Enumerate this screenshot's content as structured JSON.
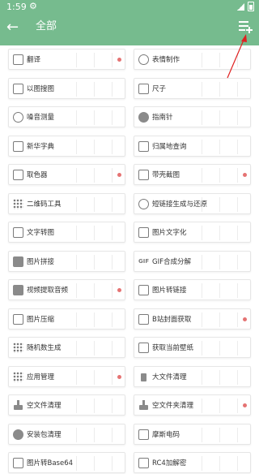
{
  "status_bar": {
    "time": "1:59"
  },
  "header": {
    "title": "全部",
    "accent": "#76bb8e"
  },
  "icons": {
    "back": "arrow-left-icon",
    "menu": "playlist-add-icon"
  },
  "badge_color": "#e57373",
  "items": [
    {
      "left": {
        "label": "翻译",
        "icon": "translate-icon",
        "dot": true
      },
      "right": {
        "label": "表情制作",
        "icon": "emoji-icon",
        "dot": false
      }
    },
    {
      "left": {
        "label": "以图搜图",
        "icon": "image-search-icon",
        "dot": false
      },
      "right": {
        "label": "尺子",
        "icon": "ruler-icon",
        "dot": false
      }
    },
    {
      "left": {
        "label": "噪音测量",
        "icon": "noise-icon",
        "dot": false
      },
      "right": {
        "label": "指南针",
        "icon": "compass-icon",
        "dot": false
      }
    },
    {
      "left": {
        "label": "新华字典",
        "icon": "book-icon",
        "dot": false
      },
      "right": {
        "label": "归属地查询",
        "icon": "phone-icon",
        "dot": false
      }
    },
    {
      "left": {
        "label": "取色器",
        "icon": "color-picker-icon",
        "dot": true
      },
      "right": {
        "label": "带壳截图",
        "icon": "phone-frame-icon",
        "dot": true
      }
    },
    {
      "left": {
        "label": "二维码工具",
        "icon": "qrcode-icon",
        "dot": false
      },
      "right": {
        "label": "短链接生成与还原",
        "icon": "link-icon",
        "dot": false
      }
    },
    {
      "left": {
        "label": "文字转图",
        "icon": "text-image-icon",
        "dot": false
      },
      "right": {
        "label": "图片文字化",
        "icon": "image-text-icon",
        "dot": false
      }
    },
    {
      "left": {
        "label": "图片拼接",
        "icon": "image-join-icon",
        "dot": false
      },
      "right": {
        "label": "GIF合成分解",
        "icon": "gif-icon",
        "dot": false
      }
    },
    {
      "left": {
        "label": "视频提取音频",
        "icon": "video-audio-icon",
        "dot": true
      },
      "right": {
        "label": "图片转链接",
        "icon": "image-link-icon",
        "dot": false
      }
    },
    {
      "left": {
        "label": "图片压缩",
        "icon": "image-compress-icon",
        "dot": false
      },
      "right": {
        "label": "B站封面获取",
        "icon": "cover-icon",
        "dot": true
      }
    },
    {
      "left": {
        "label": "随机数生成",
        "icon": "dice-icon",
        "dot": false
      },
      "right": {
        "label": "获取当前壁纸",
        "icon": "wallpaper-icon",
        "dot": false
      }
    },
    {
      "left": {
        "label": "应用管理",
        "icon": "apps-icon",
        "dot": true
      },
      "right": {
        "label": "大文件清理",
        "icon": "trash-icon",
        "dot": false
      }
    },
    {
      "left": {
        "label": "空文件清理",
        "icon": "brush-icon",
        "dot": false
      },
      "right": {
        "label": "空文件夹清理",
        "icon": "brush-icon",
        "dot": true
      }
    },
    {
      "left": {
        "label": "安装包清理",
        "icon": "circle-icon",
        "dot": false
      },
      "right": {
        "label": "摩斯电码",
        "icon": "morse-icon",
        "dot": false
      }
    },
    {
      "left": {
        "label": "图片转Base64",
        "icon": "image-base64-icon",
        "dot": false
      },
      "right": {
        "label": "RC4加解密",
        "icon": "lock-icon",
        "dot": false
      }
    }
  ]
}
